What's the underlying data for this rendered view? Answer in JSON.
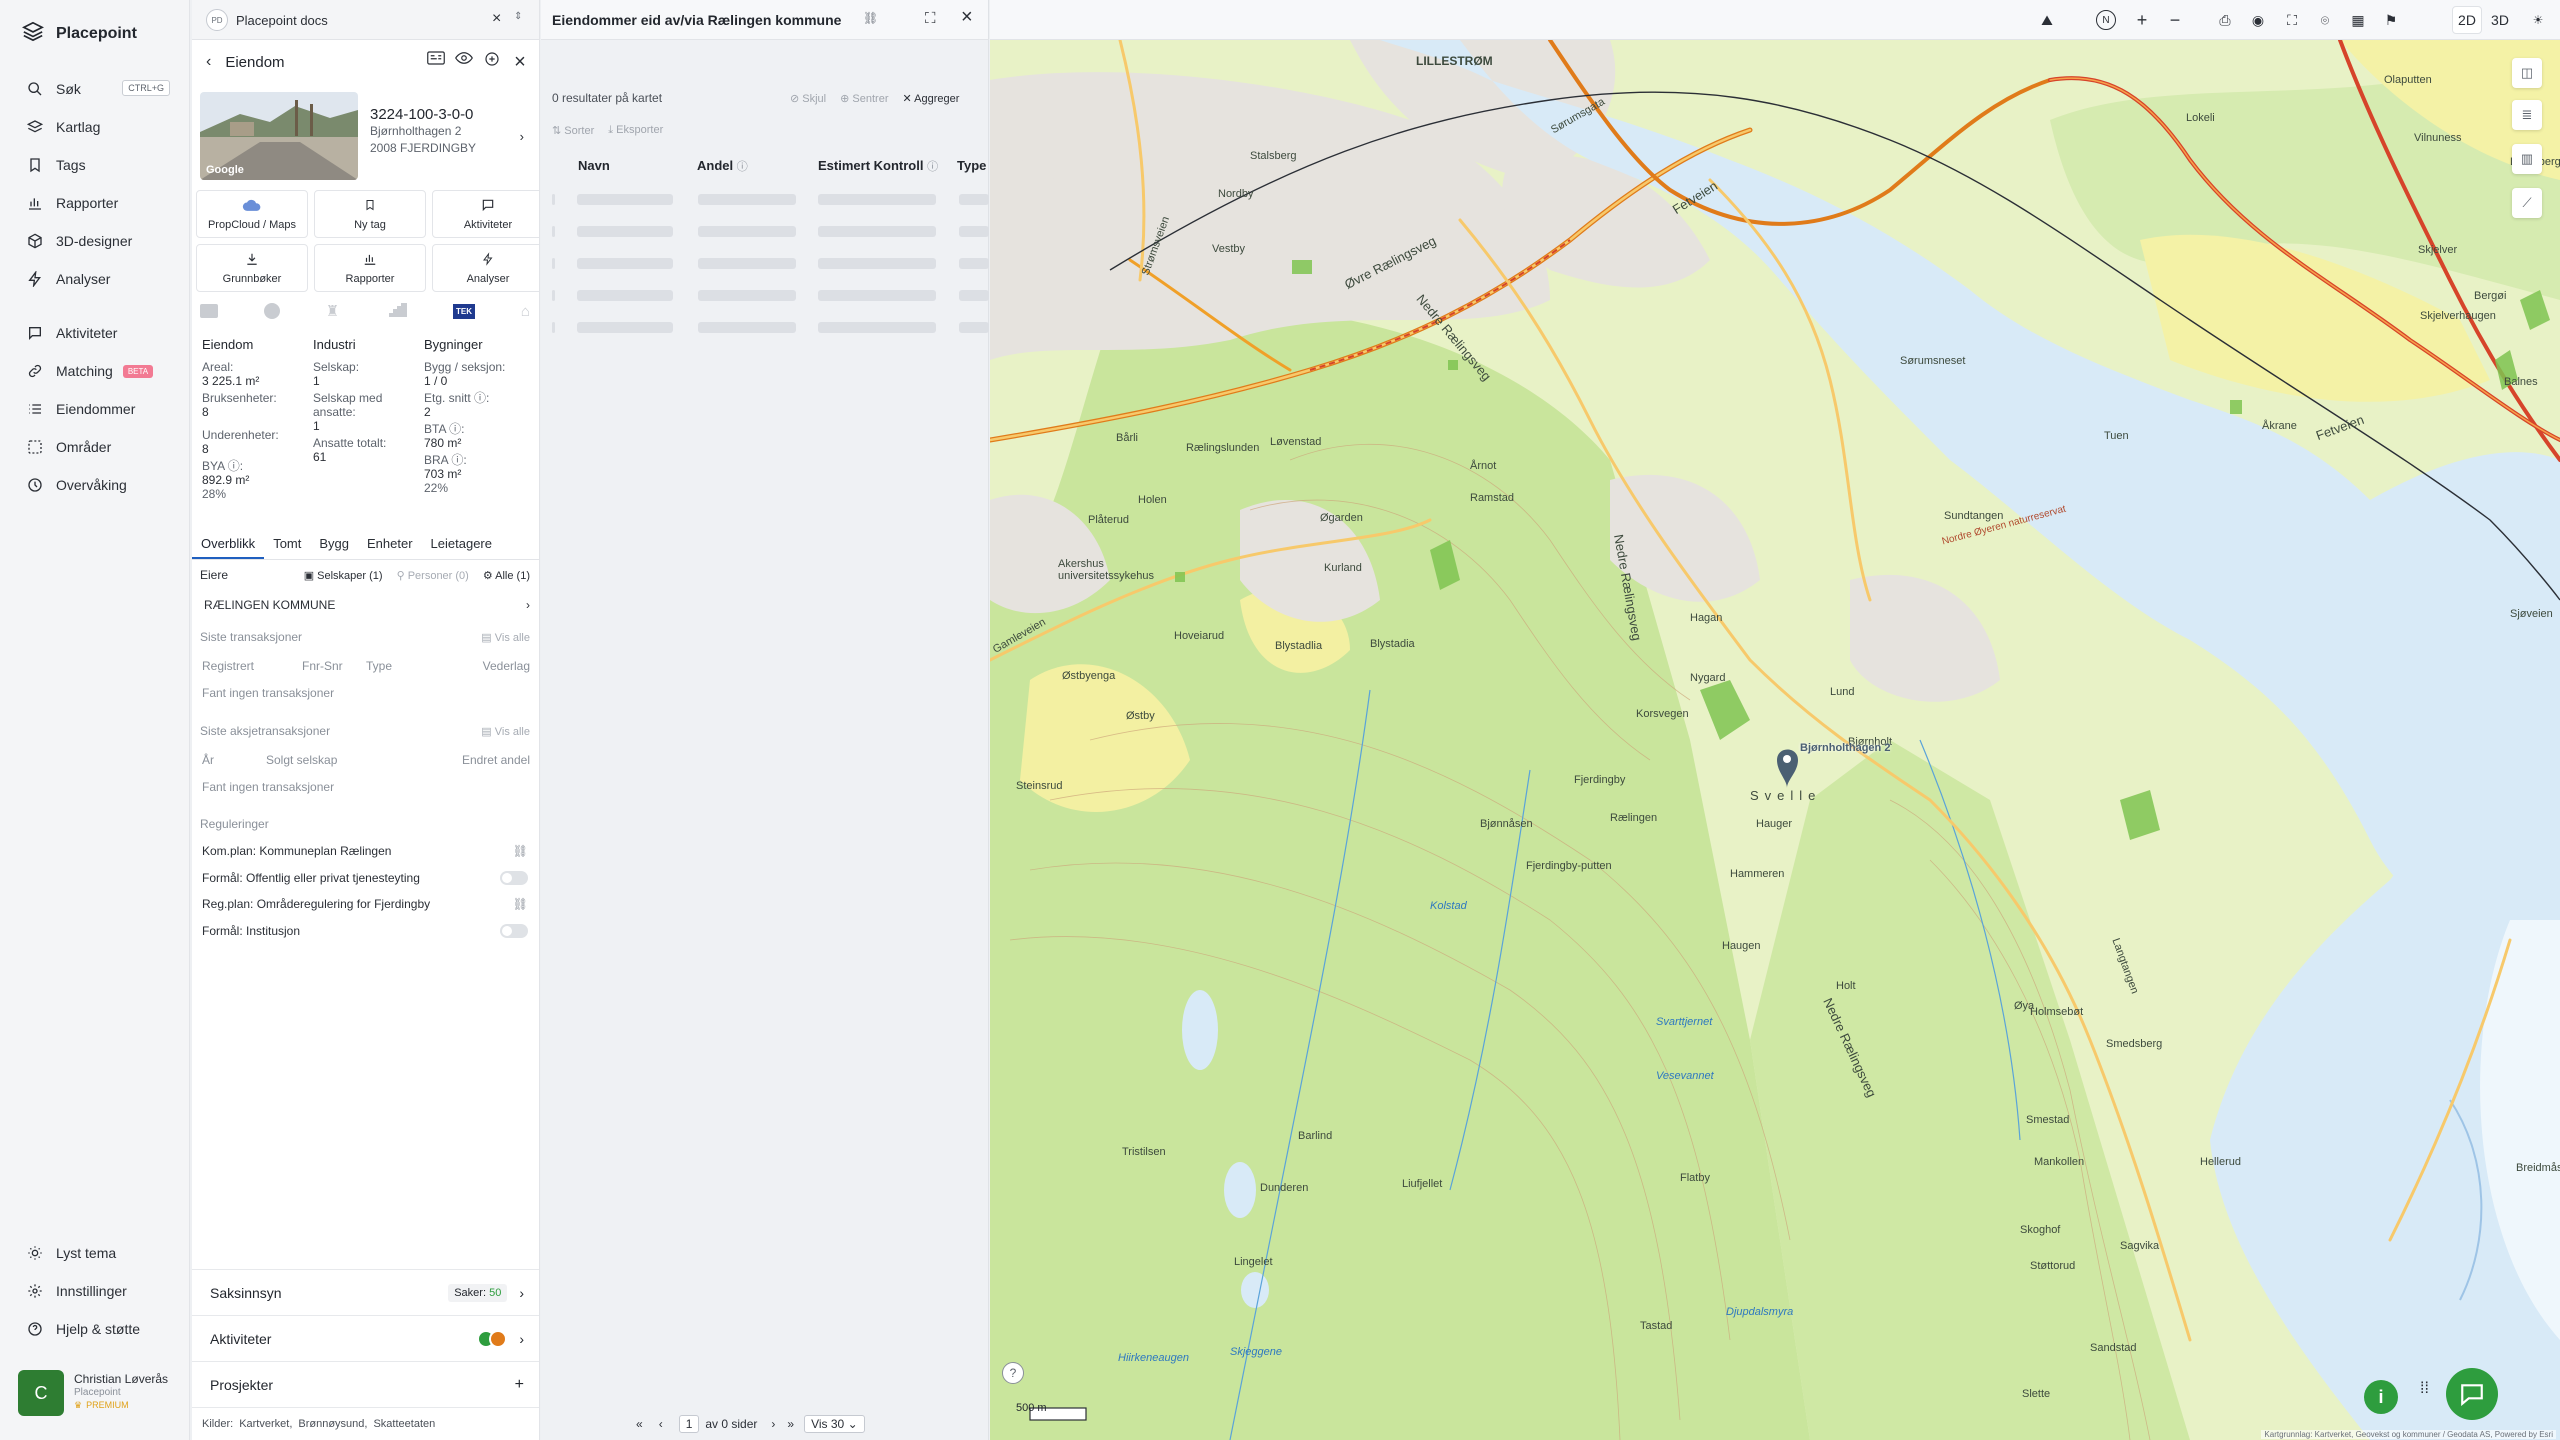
{
  "app": {
    "brand": "Placepoint"
  },
  "nav": {
    "items": [
      {
        "label": "Søk",
        "shortcut": "CTRL+G"
      },
      {
        "label": "Kartlag"
      },
      {
        "label": "Tags"
      },
      {
        "label": "Rapporter"
      },
      {
        "label": "3D-designer"
      },
      {
        "label": "Analyser"
      }
    ],
    "items2": [
      {
        "label": "Aktiviteter"
      },
      {
        "label": "Matching",
        "badge": "BETA"
      },
      {
        "label": "Eiendommer"
      },
      {
        "label": "Områder"
      },
      {
        "label": "Overvåking"
      }
    ],
    "footer": [
      {
        "label": "Lyst tema"
      },
      {
        "label": "Innstillinger"
      },
      {
        "label": "Hjelp & støtte"
      }
    ]
  },
  "user": {
    "initial": "C",
    "name": "Christian Løverås",
    "org": "Placepoint",
    "plan": "PREMIUM"
  },
  "doc_tab": {
    "chip": "PD",
    "title": "Placepoint docs"
  },
  "property": {
    "header": "Eiendom",
    "id": "3224-100-3-0-0",
    "address": "Bjørnholthagen 2",
    "postal": "2008 FJERDINGBY",
    "photo_credit": "Google",
    "actions": [
      {
        "label": "PropCloud / Maps"
      },
      {
        "label": "Ny tag"
      },
      {
        "label": "Aktiviteter"
      },
      {
        "label": "Grunnbøker"
      },
      {
        "label": "Rapporter"
      },
      {
        "label": "Analyser"
      }
    ],
    "tek_badge": "TEK",
    "stats": {
      "eiendom": {
        "head": "Eiendom",
        "areal_lbl": "Areal:",
        "areal": "3 225.1 m²",
        "bruks_lbl": "Bruksenheter:",
        "bruks": "8",
        "under_lbl": "Underenheter:",
        "under": "8",
        "bya_lbl": "BYA ⓘ:",
        "bya": "892.9 m²",
        "bya_pct": "28%"
      },
      "industri": {
        "head": "Industri",
        "selskap_lbl": "Selskap:",
        "selskap": "1",
        "selskap_ans_lbl": "Selskap med ansatte:",
        "selskap_ans": "1",
        "ansatte_lbl": "Ansatte totalt:",
        "ansatte": "61"
      },
      "bygninger": {
        "head": "Bygninger",
        "bygg_lbl": "Bygg / seksjon:",
        "bygg": "1 / 0",
        "etg_lbl": "Etg. snitt ⓘ:",
        "etg": "2",
        "bta_lbl": "BTA ⓘ:",
        "bta": "780 m²",
        "bra_lbl": "BRA ⓘ:",
        "bra": "703 m²",
        "bra_pct": "22%"
      }
    },
    "subtabs": [
      "Overblikk",
      "Tomt",
      "Bygg",
      "Enheter",
      "Leietagere"
    ],
    "owners": {
      "label": "Eiere",
      "f_selskaper": "Selskaper (1)",
      "f_personer": "Personer (0)",
      "f_alle": "Alle (1)",
      "owner": "RÆLINGEN KOMMUNE"
    },
    "transactions": {
      "label": "Siste transaksjoner",
      "see_all": "Vis alle",
      "cols": [
        "Registrert",
        "Fnr-Snr",
        "Type",
        "Vederlag"
      ],
      "empty": "Fant ingen transaksjoner"
    },
    "share_tx": {
      "label": "Siste aksjetransaksjoner",
      "see_all": "Vis alle",
      "cols": [
        "År",
        "Solgt selskap",
        "Endret andel"
      ],
      "empty": "Fant ingen transaksjoner"
    },
    "regulations": {
      "label": "Reguleringer",
      "items": [
        {
          "text": "Kom.plan: Kommuneplan Rælingen"
        },
        {
          "text": "Formål: Offentlig eller privat tjenesteyting"
        },
        {
          "text": "Reg.plan: Områderegulering for Fjerdingby"
        },
        {
          "text": "Formål: Institusjon"
        }
      ]
    },
    "accordions": {
      "saksinnsyn": "Saksinnsyn",
      "saker_lbl": "Saker:",
      "saker": "50",
      "aktiviteter": "Aktiviteter",
      "prosjekter": "Prosjekter"
    },
    "sources": {
      "label": "Kilder:",
      "items": [
        "Kartverket,",
        "Brønnøysund,",
        "Skatteetaten"
      ]
    }
  },
  "results": {
    "title": "Eiendommer eid av/via Rælingen kommune",
    "count_text": "0 resultater på kartet",
    "hide": "Skjul",
    "center": "Sentrer",
    "aggregate": "Aggreger",
    "sort": "Sorter",
    "export": "Eksporter",
    "columns": [
      "Navn",
      "Andel",
      "Estimert Kontroll",
      "Type"
    ],
    "pager": {
      "page": "1",
      "of": "av 0 sider",
      "per_page": "Vis 30"
    }
  },
  "map": {
    "mode_2d": "2D",
    "mode_3d": "3D",
    "scale": "500 m",
    "compass": "N",
    "marker_label": "Bjørnholthagen 2",
    "attribution": "Kartgrunnlag: Kartverket, Geovekst og kommuner / Geodata AS, Powered by Esri",
    "places": [
      "LILLESTRØM",
      "Sørumsgata",
      "Lillestrøm",
      "Stalsberg",
      "Nordby",
      "Vestby",
      "Strømsveien",
      "Øvre Rælingsveg",
      "Fetveien",
      "Sørumsneset",
      "Tuen",
      "Åkrane",
      "Nedre Rælingsveg",
      "Bårli",
      "Løvenstad",
      "Holen",
      "Plåterud",
      "Akershus universitetssykehus",
      "Kurland",
      "Fjerdingby",
      "Rælingen",
      "Hammeren",
      "Svelle",
      "Nordre Øyeren naturreservat",
      "Sundtangen",
      "Gamleveien",
      "Hoveiarud",
      "Østbyenga",
      "Østby",
      "Steinsrud",
      "Bjønnåsen",
      "Blystadlia",
      "Blystadia",
      "Hagan",
      "Nygard",
      "Korsvegen",
      "Lund",
      "Bjørnholt",
      "Hauger",
      "Haugen",
      "Holt",
      "Øya",
      "Smestad",
      "Mankollen",
      "Fjerdingby-putten",
      "Kolstad",
      "Rælingslunden",
      "Øgarden",
      "Årnot",
      "Ramstad",
      "Barlind",
      "Dunderen",
      "Lingelet",
      "Liufjellet",
      "Tristilsen",
      "Flatby",
      "Skoghof",
      "Slette",
      "Støttorud",
      "Sagvika",
      "Hellerud",
      "Tastad",
      "Sandstad",
      "Holmsebøt",
      "Langtangen",
      "Smedsberg",
      "Lokeli",
      "Vilnuness",
      "Skjelver",
      "Skjelverhaugen",
      "Bergøi",
      "Balnes",
      "Lørenbergholen",
      "Sjøveien",
      "Olaputten",
      "Breidmåsan",
      "Svarttjernet",
      "Vesevannet",
      "Djupdalsmyra",
      "Hiirkeneaugen",
      "Skjeggene"
    ]
  },
  "colors": {
    "accent": "#1f5fbf",
    "beta": "#f27a93",
    "avatar": "#2e7d32",
    "map_land": "#e8f2c6",
    "map_water": "#d8eaf7",
    "map_forest": "#c9e59c",
    "map_road": "#f0a028",
    "map_urban": "#e6e3de"
  }
}
